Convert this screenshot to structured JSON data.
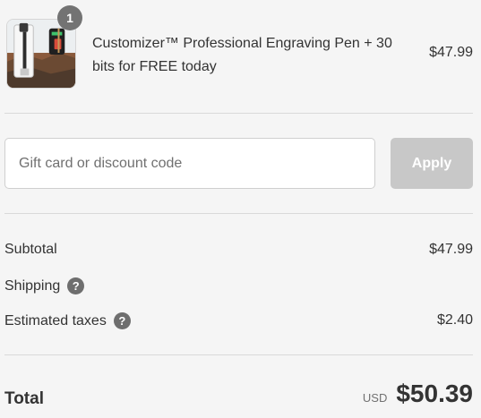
{
  "product": {
    "quantity": "1",
    "title": "Customizer™ Professional Engraving Pen + 30 bits for FREE today",
    "price": "$47.99",
    "image_icon": "engraving-pen-product-photo"
  },
  "discount": {
    "placeholder": "Gift card or discount code",
    "value": "",
    "apply_label": "Apply"
  },
  "summary": {
    "subtotal_label": "Subtotal",
    "subtotal_value": "$47.99",
    "shipping_label": "Shipping",
    "shipping_help": "?",
    "taxes_label": "Estimated taxes",
    "taxes_help": "?",
    "taxes_value": "$2.40"
  },
  "total": {
    "label": "Total",
    "currency": "USD",
    "amount": "$50.39"
  },
  "colors": {
    "background": "#f5f5f5",
    "badge": "#737373",
    "apply_button_disabled": "#c8c8c8",
    "help_icon": "#6e6e6e"
  }
}
